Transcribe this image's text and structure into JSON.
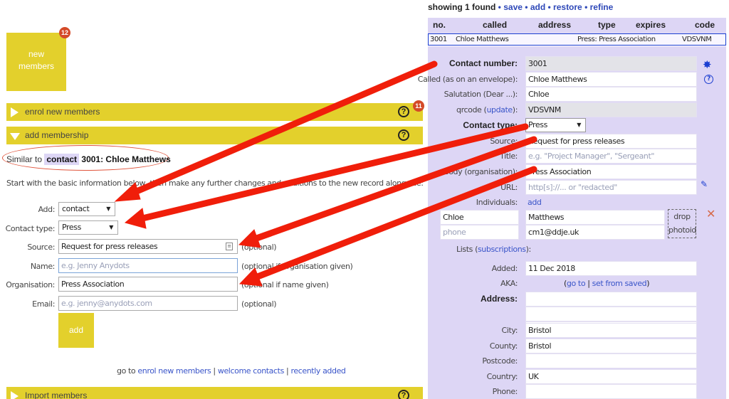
{
  "left": {
    "tile": {
      "label": "new\nmembers",
      "badge": "12"
    },
    "bars": [
      {
        "label": "enrol new members",
        "badge": "11"
      },
      {
        "label": "add membership"
      },
      {
        "label": "Import members"
      }
    ],
    "help_glyph": "?",
    "similar": {
      "prefix": "Similar to",
      "chip": "contact",
      "text": "3001: Chloe Matthews"
    },
    "intro": "Start with the basic information below, then make any further changes and additions to the new record alongside:",
    "form": {
      "add_label": "Add:",
      "add_value": "contact",
      "type_label": "Contact type:",
      "type_value": "Press",
      "source_label": "Source:",
      "source_value": "Request for press releases",
      "source_hint": "(optional)",
      "name_label": "Name:",
      "name_placeholder": "e.g. Jenny Anydots",
      "name_hint": "(optional if organisation given)",
      "org_label": "Organisation:",
      "org_value": "Press Association",
      "org_hint": "(optional if name given)",
      "email_label": "Email:",
      "email_placeholder": "e.g. jenny@anydots.com",
      "email_hint": "(optional)",
      "add_button": "add"
    },
    "links": {
      "prefix": "go to",
      "l1": "enrol new members",
      "l2": "welcome contacts",
      "l3": "recently added",
      "sep": "|"
    }
  },
  "right": {
    "summary": {
      "text": "showing 1 found",
      "save": "save",
      "add": "add",
      "restore": "restore",
      "refine": "refine",
      "bullet": "•"
    },
    "headers": {
      "no": "no.",
      "called": "called",
      "address": "address",
      "type": "type",
      "expires": "expires",
      "code": "code"
    },
    "row": {
      "no": "3001",
      "called": "Chloe Matthews",
      "type": "Press: Press Association",
      "code": "VDSVNM"
    },
    "fields": {
      "contact_number_label": "Contact number:",
      "contact_number": "3001",
      "called_label": "Called (as on an envelope):",
      "called": "Chloe Matthews",
      "salutation_label": "Salutation (Dear ...):",
      "salutation": "Chloe",
      "qrcode_label": "qrcode",
      "qrcode_update": "update",
      "qrcode": "VDSVNM",
      "contact_type_label": "Contact type:",
      "contact_type": "Press",
      "source_label": "Source:",
      "source": "Request for press releases",
      "title_label": "Title:",
      "title_placeholder": "e.g. \"Project Manager\", \"Sergeant\"",
      "body_label": "Body (organisation):",
      "body": "Press Association",
      "url_label": "URL:",
      "url_placeholder": "http[s]://... or \"redacted\"",
      "individuals_label": "Individuals:",
      "individuals_add": "add",
      "first_name": "Chloe",
      "last_name": "Matthews",
      "phone_placeholder": "phone",
      "email": "cm1@ddje.uk",
      "drop_photoid": "drop\nphotoid",
      "lists_label": "Lists",
      "lists_link": "subscriptions",
      "added_label": "Added:",
      "added": "11 Dec 2018",
      "aka_label": "AKA:",
      "aka_goto": "go to",
      "aka_setfrom": "set from saved",
      "address_label": "Address:",
      "city_label": "City:",
      "city": "Bristol",
      "county_label": "County:",
      "county": "Bristol",
      "postcode_label": "Postcode:",
      "country_label": "Country:",
      "country": "UK",
      "phone_label": "Phone:"
    }
  },
  "colors": {
    "accent_yellow": "#e3d02c",
    "record_bg": "#ddd6f5",
    "link_blue": "#2e48b8",
    "arrow_red": "#f01e0a",
    "badge": "#d44a28"
  }
}
